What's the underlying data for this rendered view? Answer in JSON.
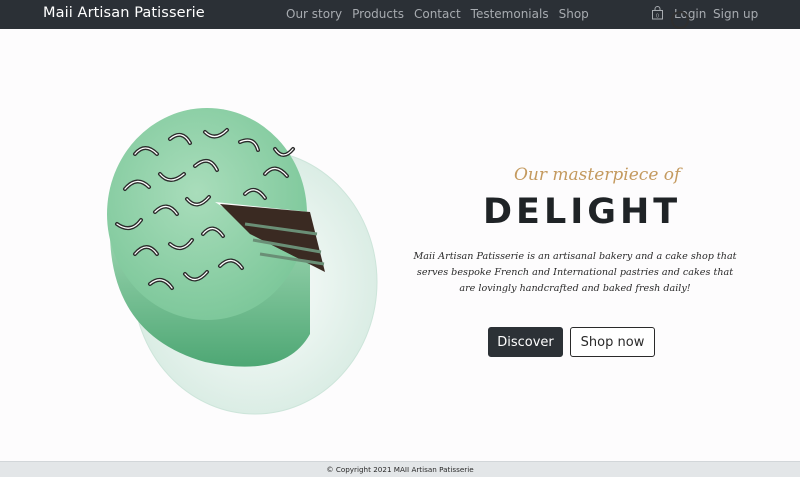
{
  "nav": {
    "brand": "Maii Artisan Patisserie",
    "links": [
      "Our story",
      "Products",
      "Contact",
      "Testemonials",
      "Shop"
    ],
    "login": "Login",
    "signup": "Sign up",
    "cart_icon": "shopping-bag-icon"
  },
  "hero": {
    "tagline": "Our masterpiece of",
    "headline": "DELIGHT",
    "description": "Maii Artisan Patisserie is an artisanal bakery and a cake shop that serves bespoke French and International pastries and cakes that are lovingly handcrafted and baked fresh daily!",
    "discover_label": "Discover",
    "shop_label": "Shop now",
    "image": "mint-chocolate-cake-image"
  },
  "footer": {
    "copyright": "© Copyright 2021 MAII Artisan Patisserie"
  },
  "colors": {
    "navbar": "#2b3036",
    "accent_gold": "#c49a5f",
    "cake_green": "#8ccfa6",
    "dark_button": "#2c3136",
    "footer": "#e3e6e8"
  }
}
